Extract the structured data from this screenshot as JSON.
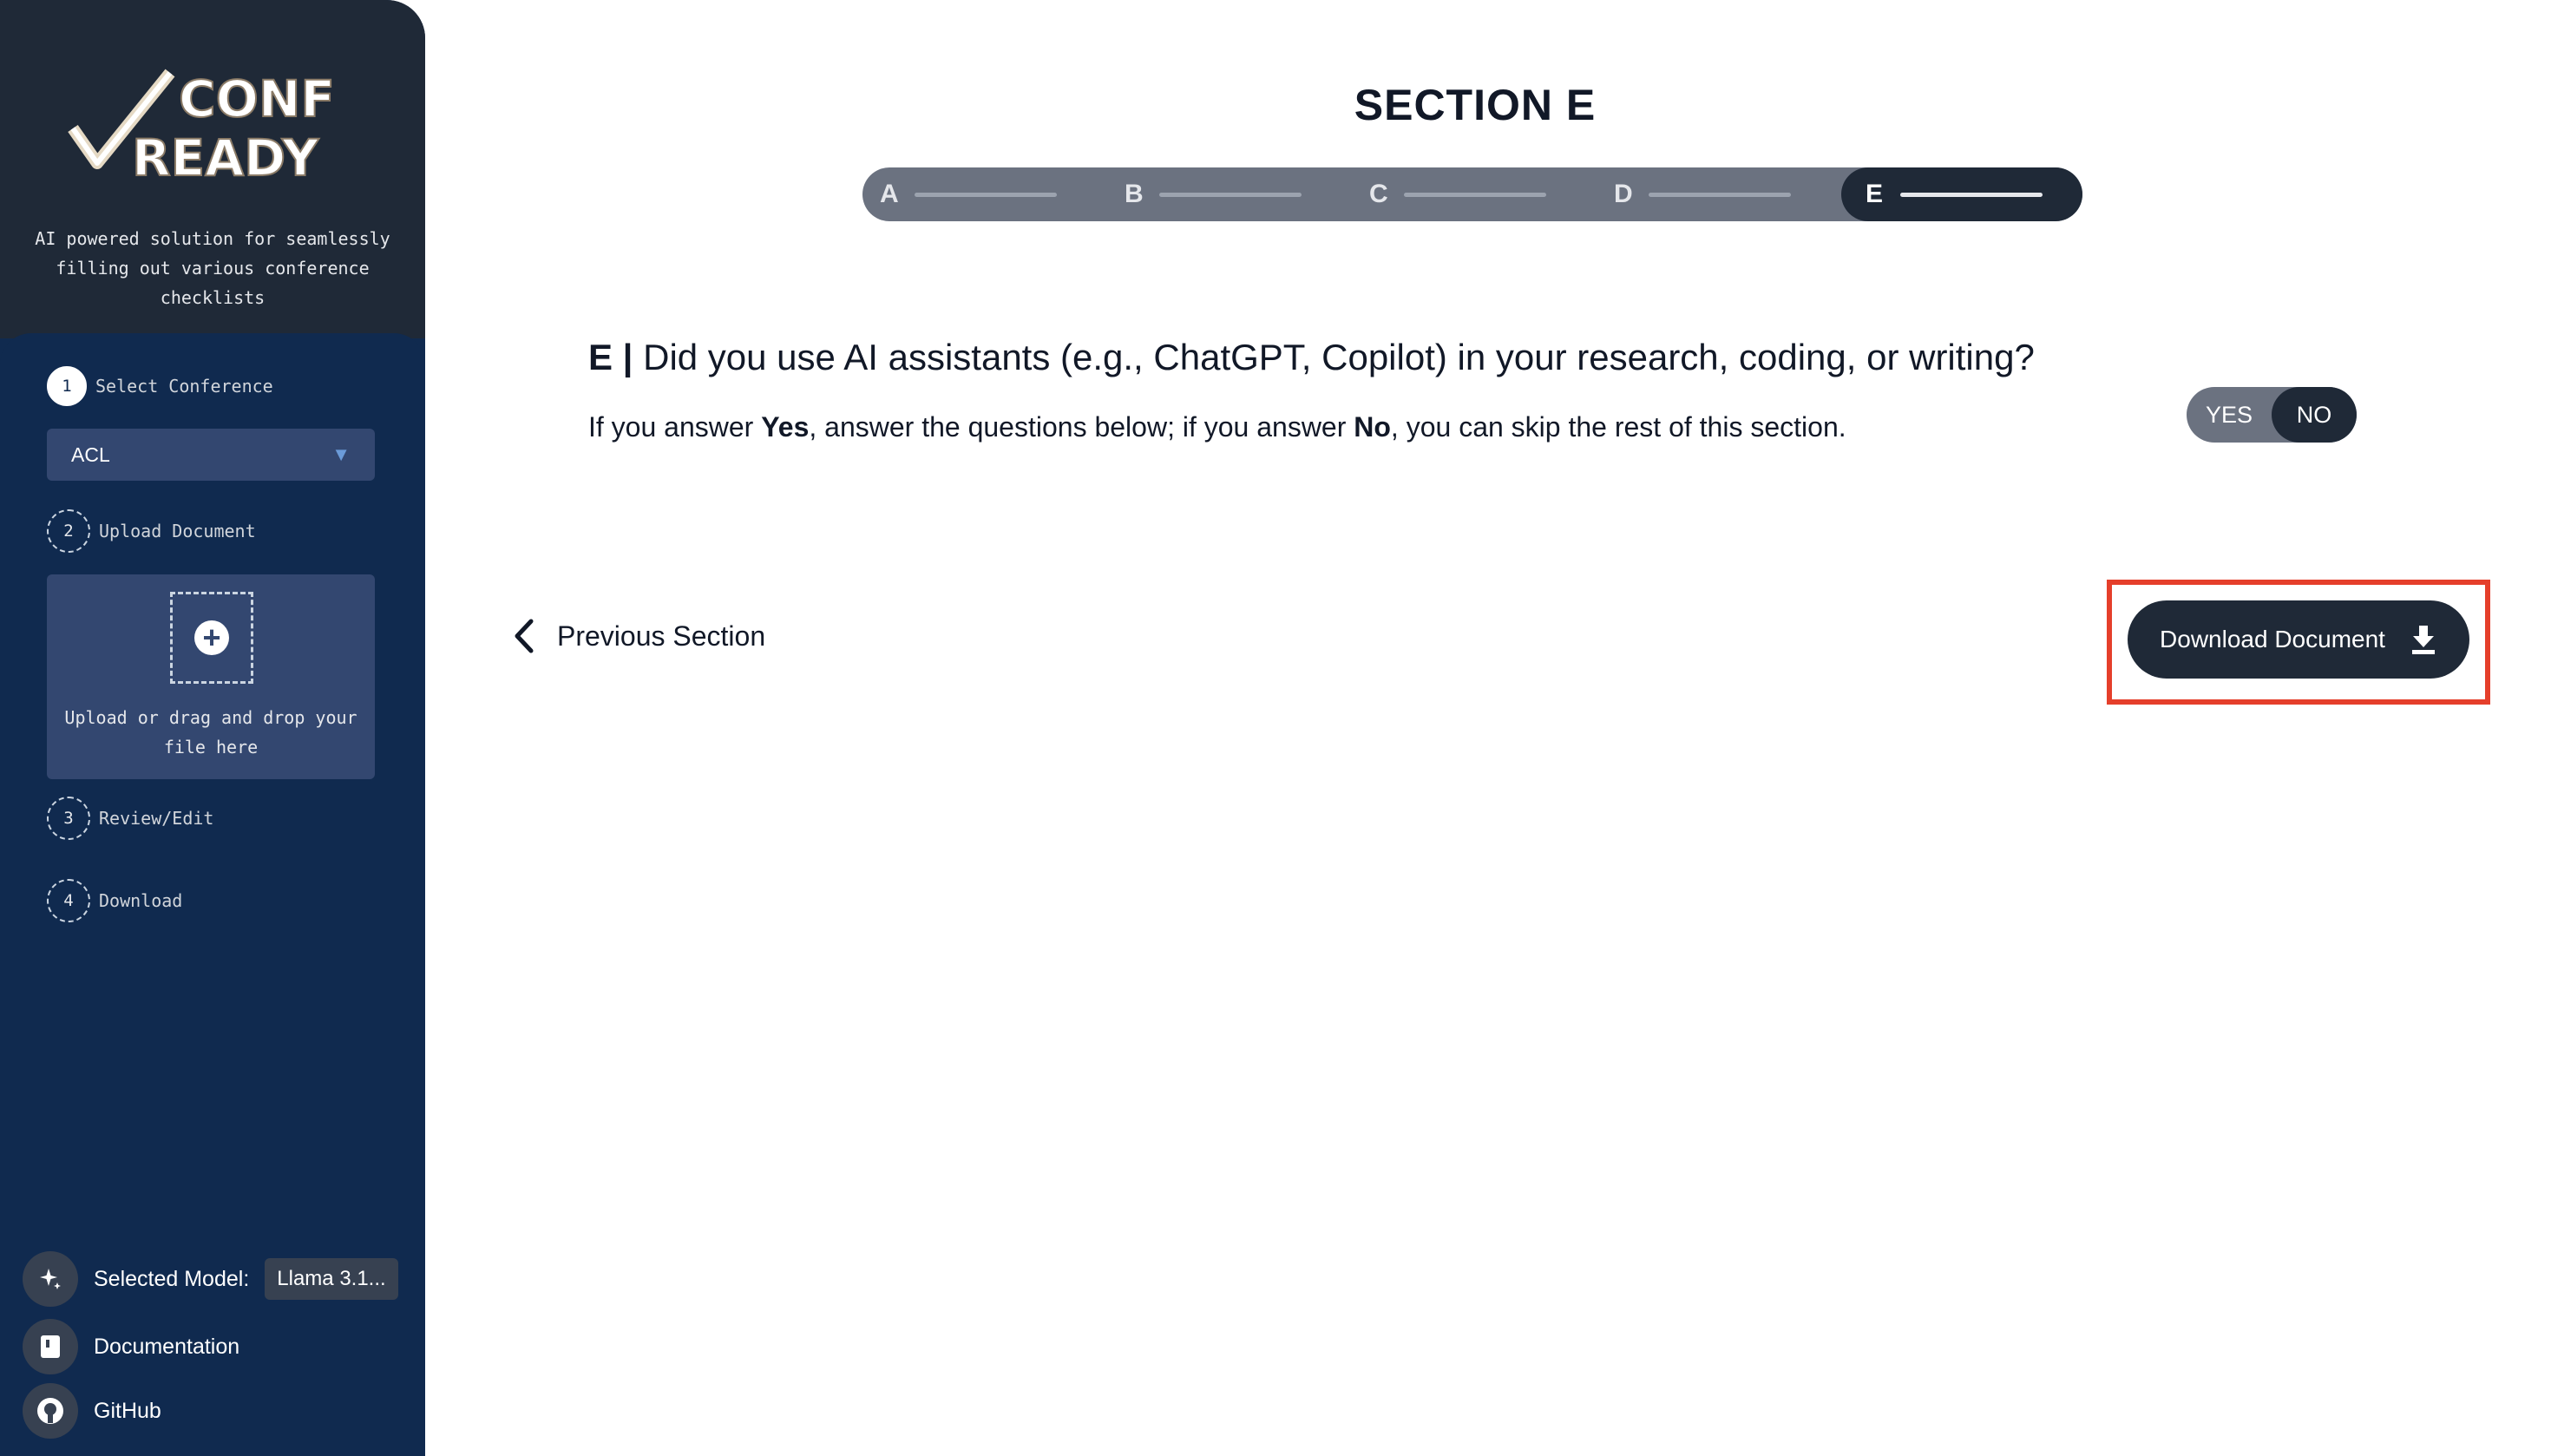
{
  "sidebar": {
    "logo": {
      "line1": "CONF",
      "line2": "READY"
    },
    "tagline": "AI powered solution for seamlessly filling out various conference checklists",
    "steps": [
      {
        "num": "1",
        "label": "Select Conference"
      },
      {
        "num": "2",
        "label": "Upload Document"
      },
      {
        "num": "3",
        "label": "Review/Edit"
      },
      {
        "num": "4",
        "label": "Download"
      }
    ],
    "conference_select": {
      "value": "ACL"
    },
    "upload": {
      "text": "Upload or drag and drop your file here"
    },
    "footer": {
      "model_label": "Selected Model:",
      "model_value": "Llama 3.1...",
      "documentation": "Documentation",
      "github": "GitHub"
    }
  },
  "main": {
    "section_title": "SECTION E",
    "stepper": [
      "A",
      "B",
      "C",
      "D",
      "E"
    ],
    "active_step": "E",
    "question": {
      "prefix": "E |",
      "text": " Did you use AI assistants (e.g., ChatGPT, Copilot) in your research, coding, or writing?"
    },
    "instruction": {
      "part1": "If you answer ",
      "yes": "Yes",
      "part2": ", answer the questions below; if you answer ",
      "no": "No",
      "part3": ", you can skip the rest of this section."
    },
    "toggle": {
      "yes": "YES",
      "no": "NO",
      "selected": "NO"
    },
    "prev_label": "Previous Section",
    "download_label": "Download Document"
  },
  "colors": {
    "sidebar": "#102a4f",
    "brand": "#1f2937",
    "accent_dark": "#1f2937",
    "highlight": "#e53f2b"
  }
}
